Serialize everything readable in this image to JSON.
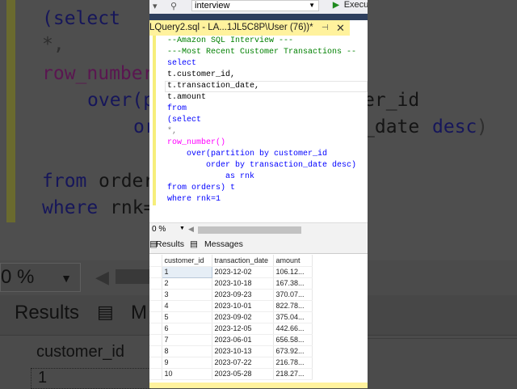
{
  "background": {
    "code_fragments": [
      {
        "text": "(select",
        "cls": "bk"
      },
      {
        "text": "*,",
        "cls": "bg2"
      },
      {
        "text": "row_number",
        "cls": "bm"
      },
      {
        "text": "over(p",
        "cls": "bk"
      },
      {
        "text": "or",
        "cls": "bk"
      },
      {
        "text": "from",
        "cls": "bk"
      },
      {
        "text": "order",
        "cls": ""
      },
      {
        "text": "where",
        "cls": "bk"
      },
      {
        "text": "rnk=",
        "cls": ""
      },
      {
        "text": "er_id",
        "cls": ""
      },
      {
        "text": "_date",
        "cls": ""
      },
      {
        "text": "desc",
        "cls": "bk"
      },
      {
        "text": ")",
        "cls": "bg2"
      }
    ],
    "zoom": "0 %",
    "results_tab": "Results",
    "messages_tab": "M",
    "grid_header": "customer_id",
    "first_cell": "1"
  },
  "toolbar": {
    "database": "interview",
    "execute": "Execu"
  },
  "doc_tab": {
    "title": "LQuery2.sql - LA...1JL5C8P\\User (76))*"
  },
  "editor": {
    "lines": [
      "--Amazon SQL Interview ---",
      "---Most Recent Customer Transactions --",
      "select",
      "t.customer_id,",
      "t.transaction_date,",
      "t.amount",
      "from",
      "(select",
      "*,",
      "row_number()",
      "    over(partition by customer_id",
      "        order by transaction_date desc)",
      "            as rnk",
      "from orders) t",
      "where rnk=1"
    ]
  },
  "zoom": "0 %",
  "results": {
    "tabs": [
      "Results",
      "Messages"
    ],
    "columns": [
      "customer_id",
      "transaction_date",
      "amount"
    ],
    "rows": [
      [
        "1",
        "2023-12-02",
        "106.12..."
      ],
      [
        "2",
        "2023-10-18",
        "167.38..."
      ],
      [
        "3",
        "2023-09-23",
        "370.07..."
      ],
      [
        "4",
        "2023-10-01",
        "822.78..."
      ],
      [
        "5",
        "2023-09-02",
        "375.04..."
      ],
      [
        "6",
        "2023-12-05",
        "442.66..."
      ],
      [
        "7",
        "2023-06-01",
        "656.58..."
      ],
      [
        "8",
        "2023-10-13",
        "673.92..."
      ],
      [
        "9",
        "2023-07-22",
        "216.78..."
      ],
      [
        "10",
        "2023-05-28",
        "218.27..."
      ]
    ]
  }
}
